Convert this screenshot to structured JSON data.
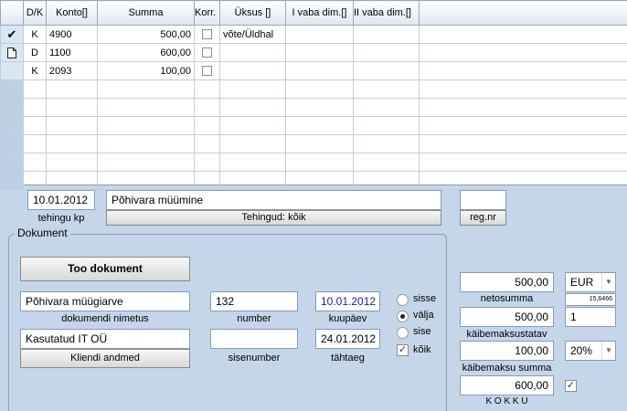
{
  "grid": {
    "columns": [
      "D/K",
      "Konto[]",
      "Summa",
      "Korr.",
      "Üksus []",
      "I vaba dim.[]",
      "II vaba dim.[]"
    ],
    "rows": [
      {
        "marker": "✔",
        "dk": "K",
        "konto": "4900",
        "summa": "500,00",
        "uksus": "võte/Üldhal"
      },
      {
        "marker": "doc",
        "dk": "D",
        "konto": "1100",
        "summa": "600,00",
        "uksus": ""
      },
      {
        "marker": "",
        "dk": "K",
        "konto": "2093",
        "summa": "100,00",
        "uksus": ""
      }
    ]
  },
  "transaction": {
    "date": "10.01.2012",
    "date_label": "tehingu kp",
    "description": "Põhivara müümine",
    "filter_button": "Tehingud: kõik",
    "reg_value": "",
    "reg_button": "reg.nr"
  },
  "document": {
    "legend": "Dokument",
    "fetch_button": "Too dokument",
    "name_value": "Põhivara müügiarve",
    "name_label": "dokumendi nimetus",
    "number_value": "132",
    "number_label": "number",
    "date_value": "10.01.2012",
    "date_label": "kuupäev",
    "client_value": "Kasutatud IT OÜ",
    "client_button": "Kliendi andmed",
    "internal_value": "",
    "internal_label": "sisenumber",
    "due_value": "24.01.2012",
    "due_label": "tähtaeg",
    "radios": [
      {
        "label": "sisse",
        "checked": false
      },
      {
        "label": "välja",
        "checked": true
      },
      {
        "label": "sise",
        "checked": false
      }
    ],
    "all_label": "kõik"
  },
  "totals": {
    "net_value": "500,00",
    "net_label": "netosumma",
    "currency": "EUR",
    "rate": "15,6466",
    "vat_base_value": "500,00",
    "vat_base_label": "käibemaksustatav",
    "vat_base_factor": "1",
    "vat_value": "100,00",
    "vat_label": "käibemaksu summa",
    "vat_rate": "20%",
    "total_value": "600,00",
    "total_label": "K O K K U"
  }
}
